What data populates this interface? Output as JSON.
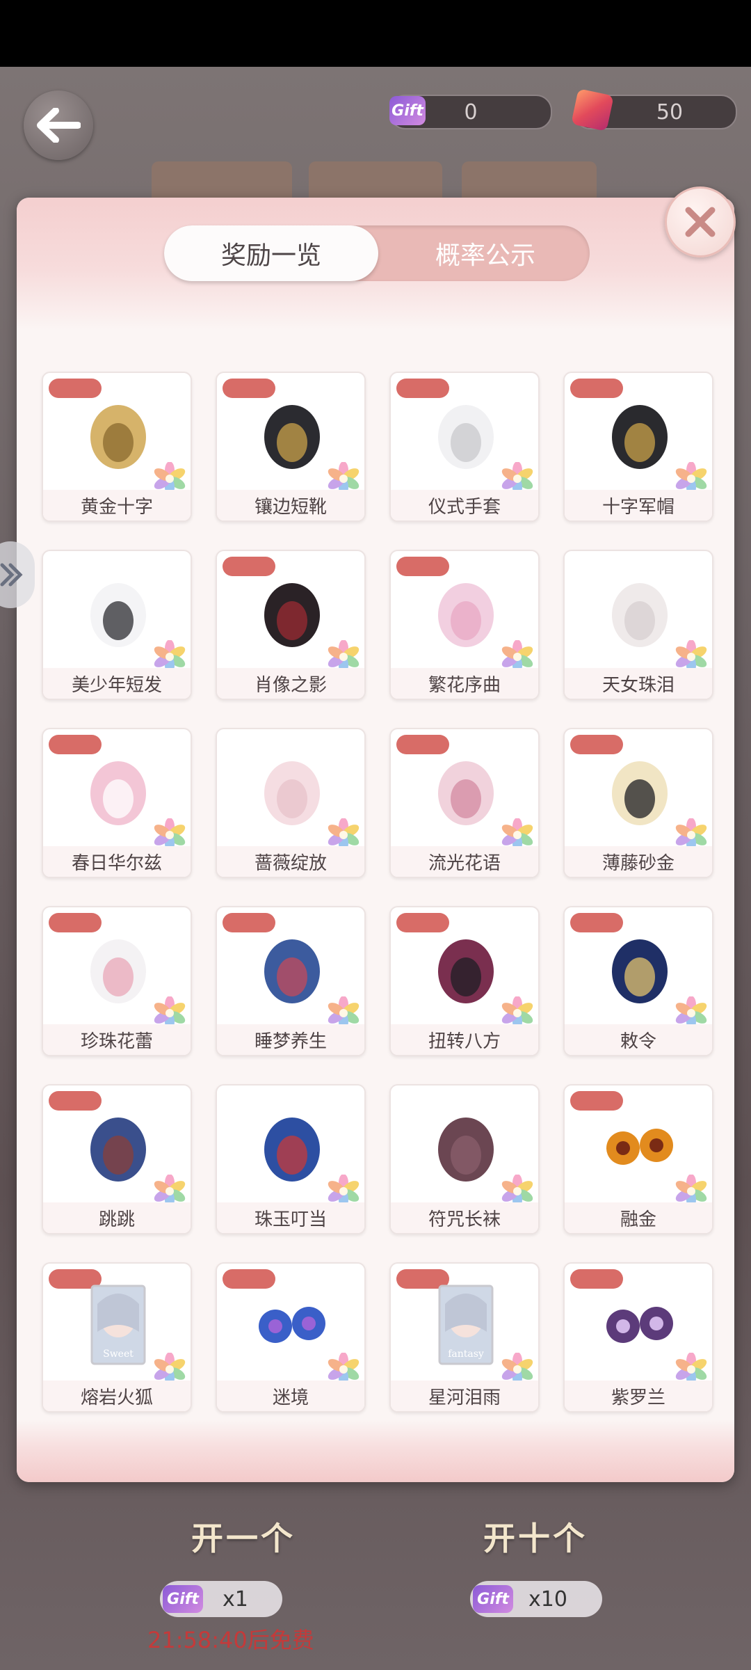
{
  "header": {
    "back_icon": "arrow-left-icon",
    "currency_ticket": {
      "icon": "gift-ticket-icon",
      "icon_text": "Gift",
      "value": "0"
    },
    "currency_gem": {
      "icon": "gem-cube-icon",
      "value": "50"
    }
  },
  "modal": {
    "tabs": [
      {
        "label": "奖励一览",
        "active": true
      },
      {
        "label": "概率公示",
        "active": false
      }
    ],
    "close_icon": "close-icon",
    "items": [
      {
        "name": "黄金十字",
        "icon": "gold-cross-earrings-icon",
        "tag": true
      },
      {
        "name": "镶边短靴",
        "icon": "black-boots-icon",
        "tag": true
      },
      {
        "name": "仪式手套",
        "icon": "white-gloves-icon",
        "tag": true
      },
      {
        "name": "十字军帽",
        "icon": "military-cap-icon",
        "tag": true
      },
      {
        "name": "美少年短发",
        "icon": "white-short-hair-icon",
        "tag": false
      },
      {
        "name": "肖像之影",
        "icon": "dark-coat-outfit-icon",
        "tag": true
      },
      {
        "name": "繁花序曲",
        "icon": "pink-dress-icon",
        "tag": true
      },
      {
        "name": "天女珠泪",
        "icon": "pearl-crown-icon",
        "tag": false
      },
      {
        "name": "春日华尔兹",
        "icon": "pink-shoes-icon",
        "tag": true
      },
      {
        "name": "蔷薇绽放",
        "icon": "lace-gloves-icon",
        "tag": false
      },
      {
        "name": "流光花语",
        "icon": "rose-fan-icon",
        "tag": true
      },
      {
        "name": "薄藤砂金",
        "icon": "blonde-hair-icon",
        "tag": true
      },
      {
        "name": "珍珠花蕾",
        "icon": "pearl-earrings-icon",
        "tag": true
      },
      {
        "name": "睡梦养生",
        "icon": "blue-robe-icon",
        "tag": true
      },
      {
        "name": "扭转八方",
        "icon": "braided-hair-icon",
        "tag": true
      },
      {
        "name": "敕令",
        "icon": "blue-hat-icon",
        "tag": true
      },
      {
        "name": "跳跳",
        "icon": "blue-boots-icon",
        "tag": true
      },
      {
        "name": "珠玉叮当",
        "icon": "jade-earrings-icon",
        "tag": false
      },
      {
        "name": "符咒长袜",
        "icon": "long-stockings-icon",
        "tag": false
      },
      {
        "name": "融金",
        "icon": "gold-eyes-icon",
        "tag": true
      },
      {
        "name": "熔岩火狐",
        "icon": "makeup-card-icon",
        "tag": true,
        "card_text": "Sweet"
      },
      {
        "name": "迷境",
        "icon": "blue-eyes-icon",
        "tag": true
      },
      {
        "name": "星河泪雨",
        "icon": "makeup-card-icon",
        "tag": true,
        "card_text": "fantasy"
      },
      {
        "name": "紫罗兰",
        "icon": "purple-eyes-icon",
        "tag": true
      }
    ]
  },
  "bottom": {
    "open_one_label": "开一个",
    "open_ten_label": "开十个",
    "cost_one": "x1",
    "cost_ten": "x10",
    "free_timer": "21:58:40后免费"
  },
  "colors": {
    "tag_red": "#d86c67",
    "modal_bg": "#fbf5f4",
    "timer_red": "#c43a3a"
  }
}
